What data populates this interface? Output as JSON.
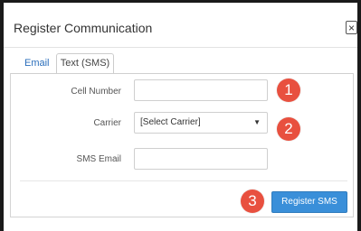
{
  "dialog": {
    "title": "Register Communication",
    "close_label": "×"
  },
  "tabs": [
    {
      "label": "Email",
      "active": false
    },
    {
      "label": "Text (SMS)",
      "active": true
    }
  ],
  "form": {
    "cell_number": {
      "label": "Cell Number",
      "value": ""
    },
    "carrier": {
      "label": "Carrier",
      "selected": "[Select Carrier]"
    },
    "sms_email": {
      "label": "SMS Email",
      "value": ""
    }
  },
  "actions": {
    "register_label": "Register SMS"
  },
  "callouts": [
    "1",
    "2",
    "3"
  ],
  "colors": {
    "callout": "#e8503f",
    "primary_button": "#3a8fd9",
    "tab_link": "#2a6ebb"
  }
}
